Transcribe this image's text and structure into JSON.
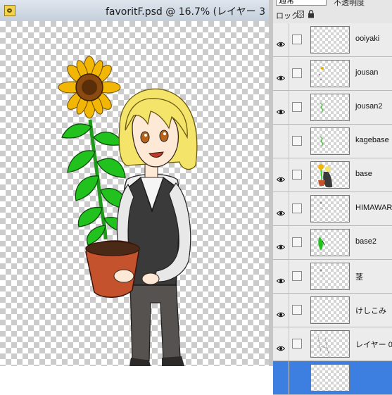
{
  "document": {
    "title": "favoritF.psd @ 16.7% (レイヤー 3",
    "icon": "photoshop-doc-icon"
  },
  "layers_panel": {
    "blend_mode": "通常",
    "opacity_label": "不透明度",
    "lock_label": "ロック:",
    "layers": [
      {
        "name": "ooiyaki",
        "visible": true,
        "thumb": "empty"
      },
      {
        "name": "jousan",
        "visible": true,
        "thumb": "specks-yellow"
      },
      {
        "name": "jousan2",
        "visible": true,
        "thumb": "specks-green"
      },
      {
        "name": "kagebase",
        "visible": false,
        "thumb": "specks-green"
      },
      {
        "name": "base",
        "visible": true,
        "thumb": "figure-colored"
      },
      {
        "name": "HIMAWARI",
        "visible": true,
        "thumb": "specks-grey"
      },
      {
        "name": "base2",
        "visible": true,
        "thumb": "leaves-green"
      },
      {
        "name": "茎",
        "visible": true,
        "thumb": "specks-grey"
      },
      {
        "name": "けしこみ",
        "visible": true,
        "thumb": "empty"
      },
      {
        "name": "レイヤー 0",
        "visible": true,
        "thumb": "lineart"
      },
      {
        "name": "",
        "visible": false,
        "thumb": "empty",
        "selected": true
      }
    ]
  },
  "colors": {
    "selection": "#3d7fe0",
    "hair": "#f4e46a",
    "petals": "#f2b705",
    "leaves": "#22c21e",
    "pot": "#c4522c",
    "vest": "#3a3a3a",
    "pants": "#565250"
  }
}
